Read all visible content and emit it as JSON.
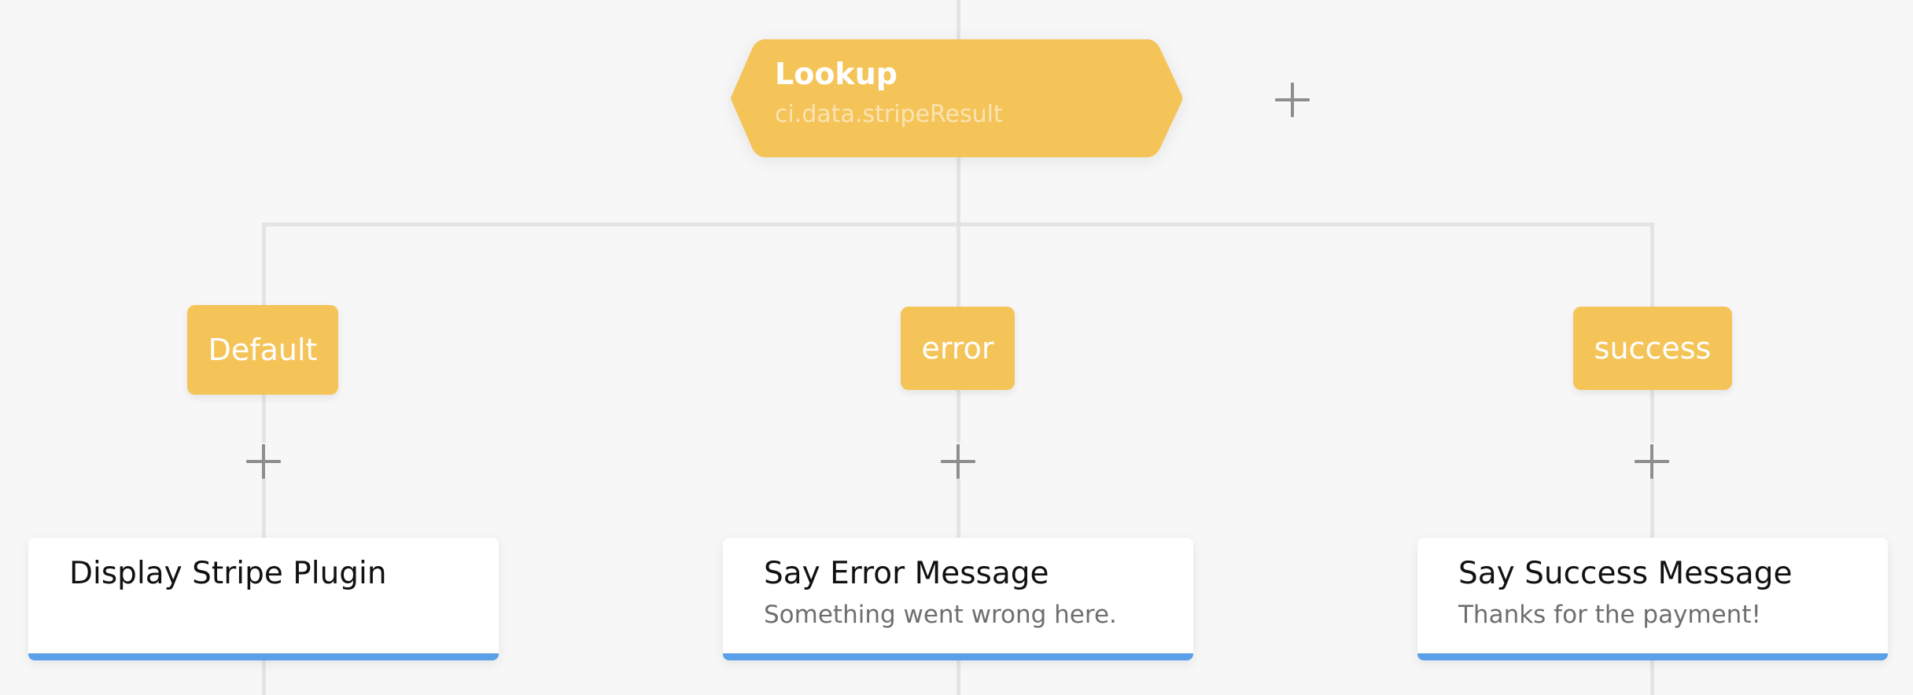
{
  "colors": {
    "background": "#f7f7f7",
    "connector": "#e4e4e4",
    "node_yellow": "#f5c458",
    "accent_blue": "#5aa0e8",
    "plus_gray": "#8e8e8e"
  },
  "lookup": {
    "title": "Lookup",
    "subtitle": "ci.data.stripeResult"
  },
  "branches": [
    {
      "label": "Default"
    },
    {
      "label": "error"
    },
    {
      "label": "success"
    }
  ],
  "cards": [
    {
      "title": "Display Stripe Plugin",
      "subtitle": ""
    },
    {
      "title": "Say Error Message",
      "subtitle": "Something went wrong here."
    },
    {
      "title": "Say Success Message",
      "subtitle": "Thanks for the payment!"
    }
  ],
  "icons": {
    "add": "add-icon"
  }
}
